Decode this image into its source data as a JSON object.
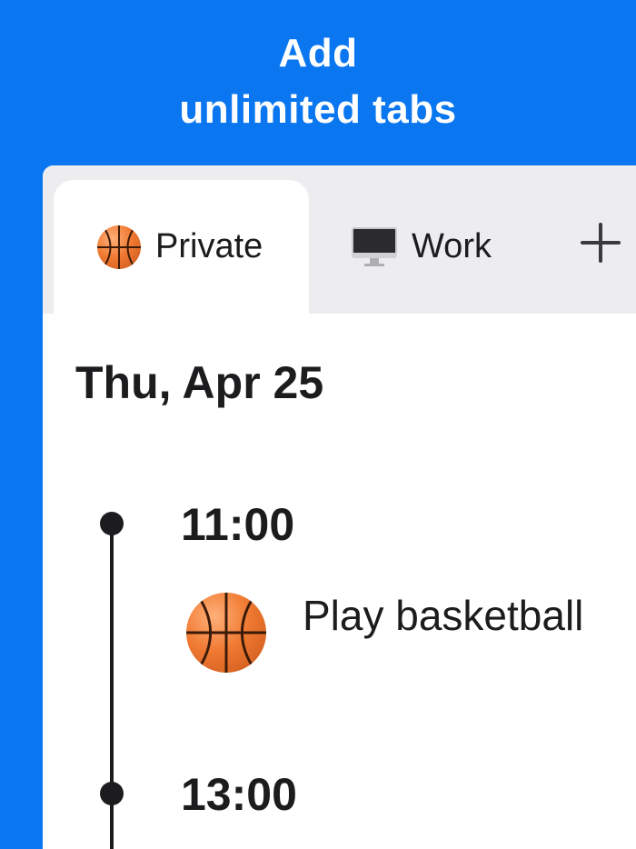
{
  "headline": {
    "line1": "Add",
    "line2": "unlimited tabs"
  },
  "tabs": [
    {
      "label": "Private",
      "icon": "basketball-icon",
      "active": true
    },
    {
      "label": "Work",
      "icon": "desktop-computer-icon",
      "active": false
    }
  ],
  "add_tab_icon": "plus-icon",
  "day": {
    "date": "Thu, Apr 25",
    "entries": [
      {
        "time": "11:00",
        "icon": "basketball-icon",
        "title": "Play basketball"
      },
      {
        "time": "13:00"
      }
    ]
  },
  "colors": {
    "background": "#0a76f0",
    "tab_bar": "#ededef",
    "text": "#1c1c1e"
  }
}
